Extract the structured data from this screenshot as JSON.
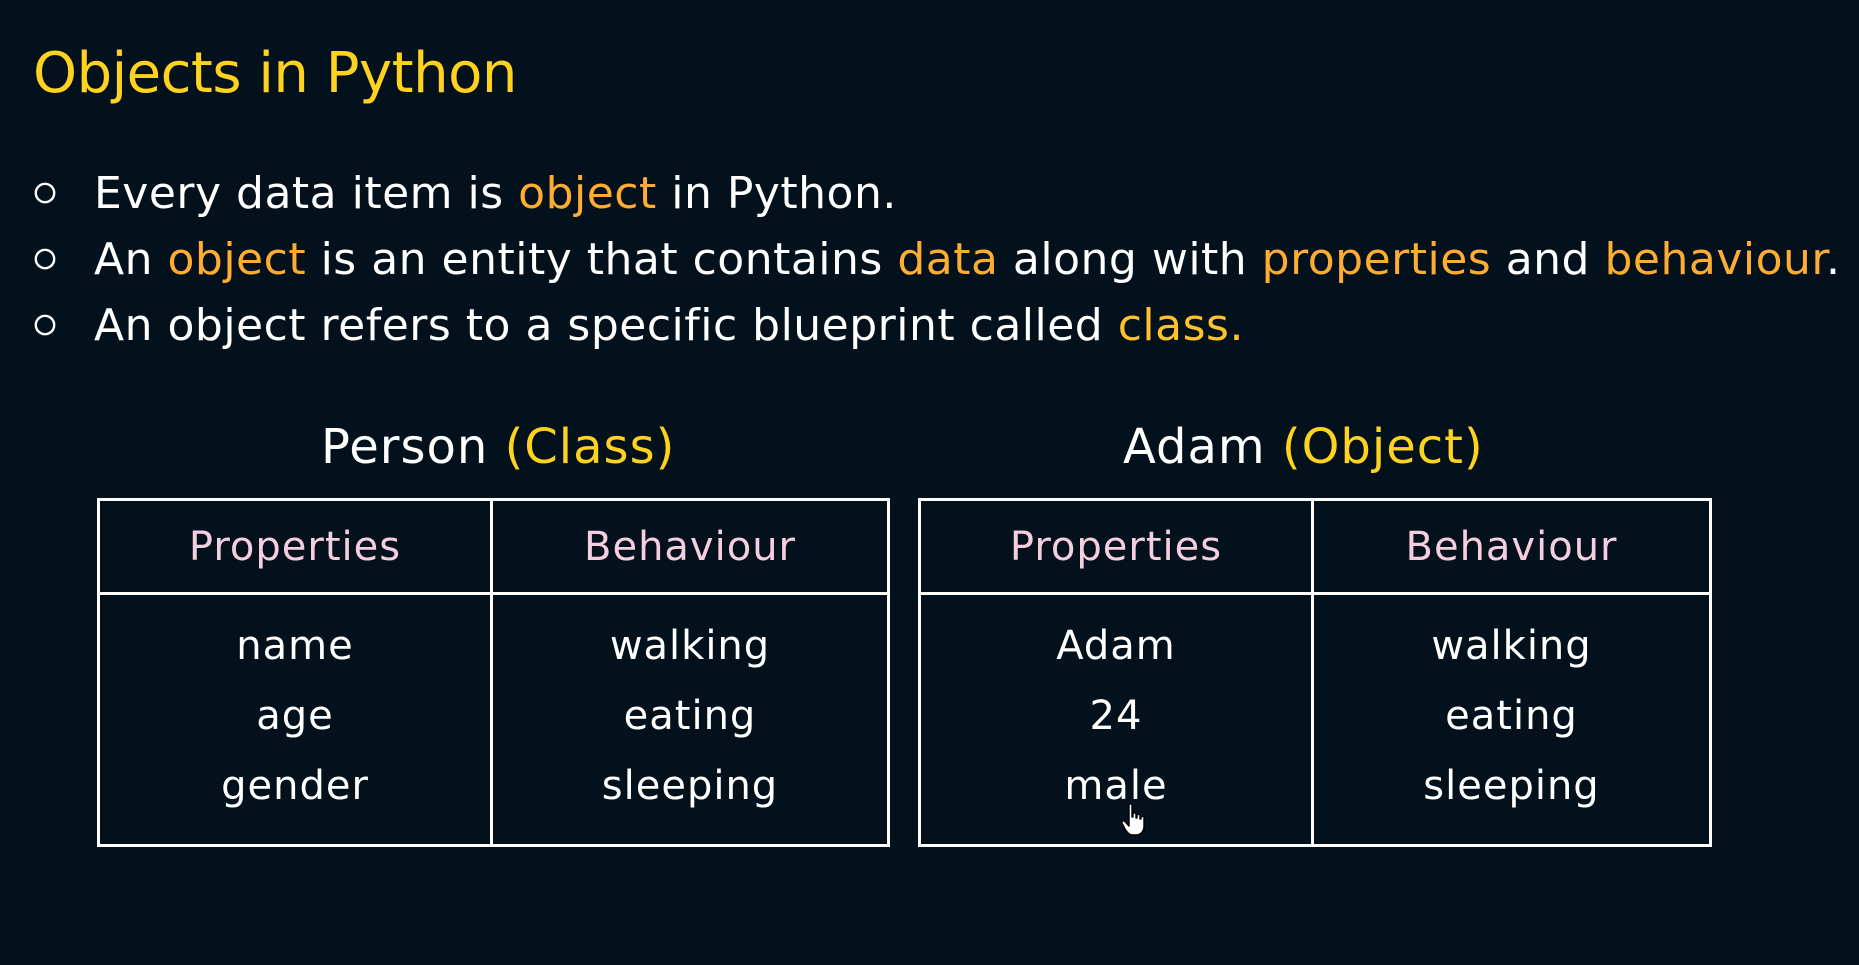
{
  "title": "Objects in Python",
  "bullets": [
    {
      "parts": [
        {
          "text": "Every data item is ",
          "hl": false
        },
        {
          "text": "object",
          "hl": true
        },
        {
          "text": " in Python.",
          "hl": false
        }
      ]
    },
    {
      "parts": [
        {
          "text": "An ",
          "hl": false
        },
        {
          "text": "object",
          "hl": true
        },
        {
          "text": " is an entity that contains ",
          "hl": false
        },
        {
          "text": "data",
          "hl": true
        },
        {
          "text": " along with ",
          "hl": false
        },
        {
          "text": "properties",
          "hl": true
        },
        {
          "text": " and ",
          "hl": false
        },
        {
          "text": "behaviour",
          "hl": true
        },
        {
          "text": ".",
          "hl": false
        }
      ]
    },
    {
      "parts": [
        {
          "text": "An object refers to a specific blueprint called ",
          "hl": false
        },
        {
          "text": "class.",
          "hl": true
        }
      ]
    }
  ],
  "class_table": {
    "name": "Person",
    "kind": "(Class)",
    "headers": [
      "Properties",
      "Behaviour"
    ],
    "properties": [
      "name",
      "age",
      "gender"
    ],
    "behaviour": [
      "walking",
      "eating",
      "sleeping"
    ]
  },
  "object_table": {
    "name": "Adam",
    "kind": "(Object)",
    "headers": [
      "Properties",
      "Behaviour"
    ],
    "properties": [
      "Adam",
      "24",
      "male"
    ],
    "behaviour": [
      "walking",
      "eating",
      "sleeping"
    ]
  },
  "colors": {
    "background": "#02111b",
    "title": "#ffd21f",
    "highlight": "#ffac33",
    "header_text": "#f7cde0"
  },
  "icons": {
    "cursor": "hand-pointer-icon"
  }
}
